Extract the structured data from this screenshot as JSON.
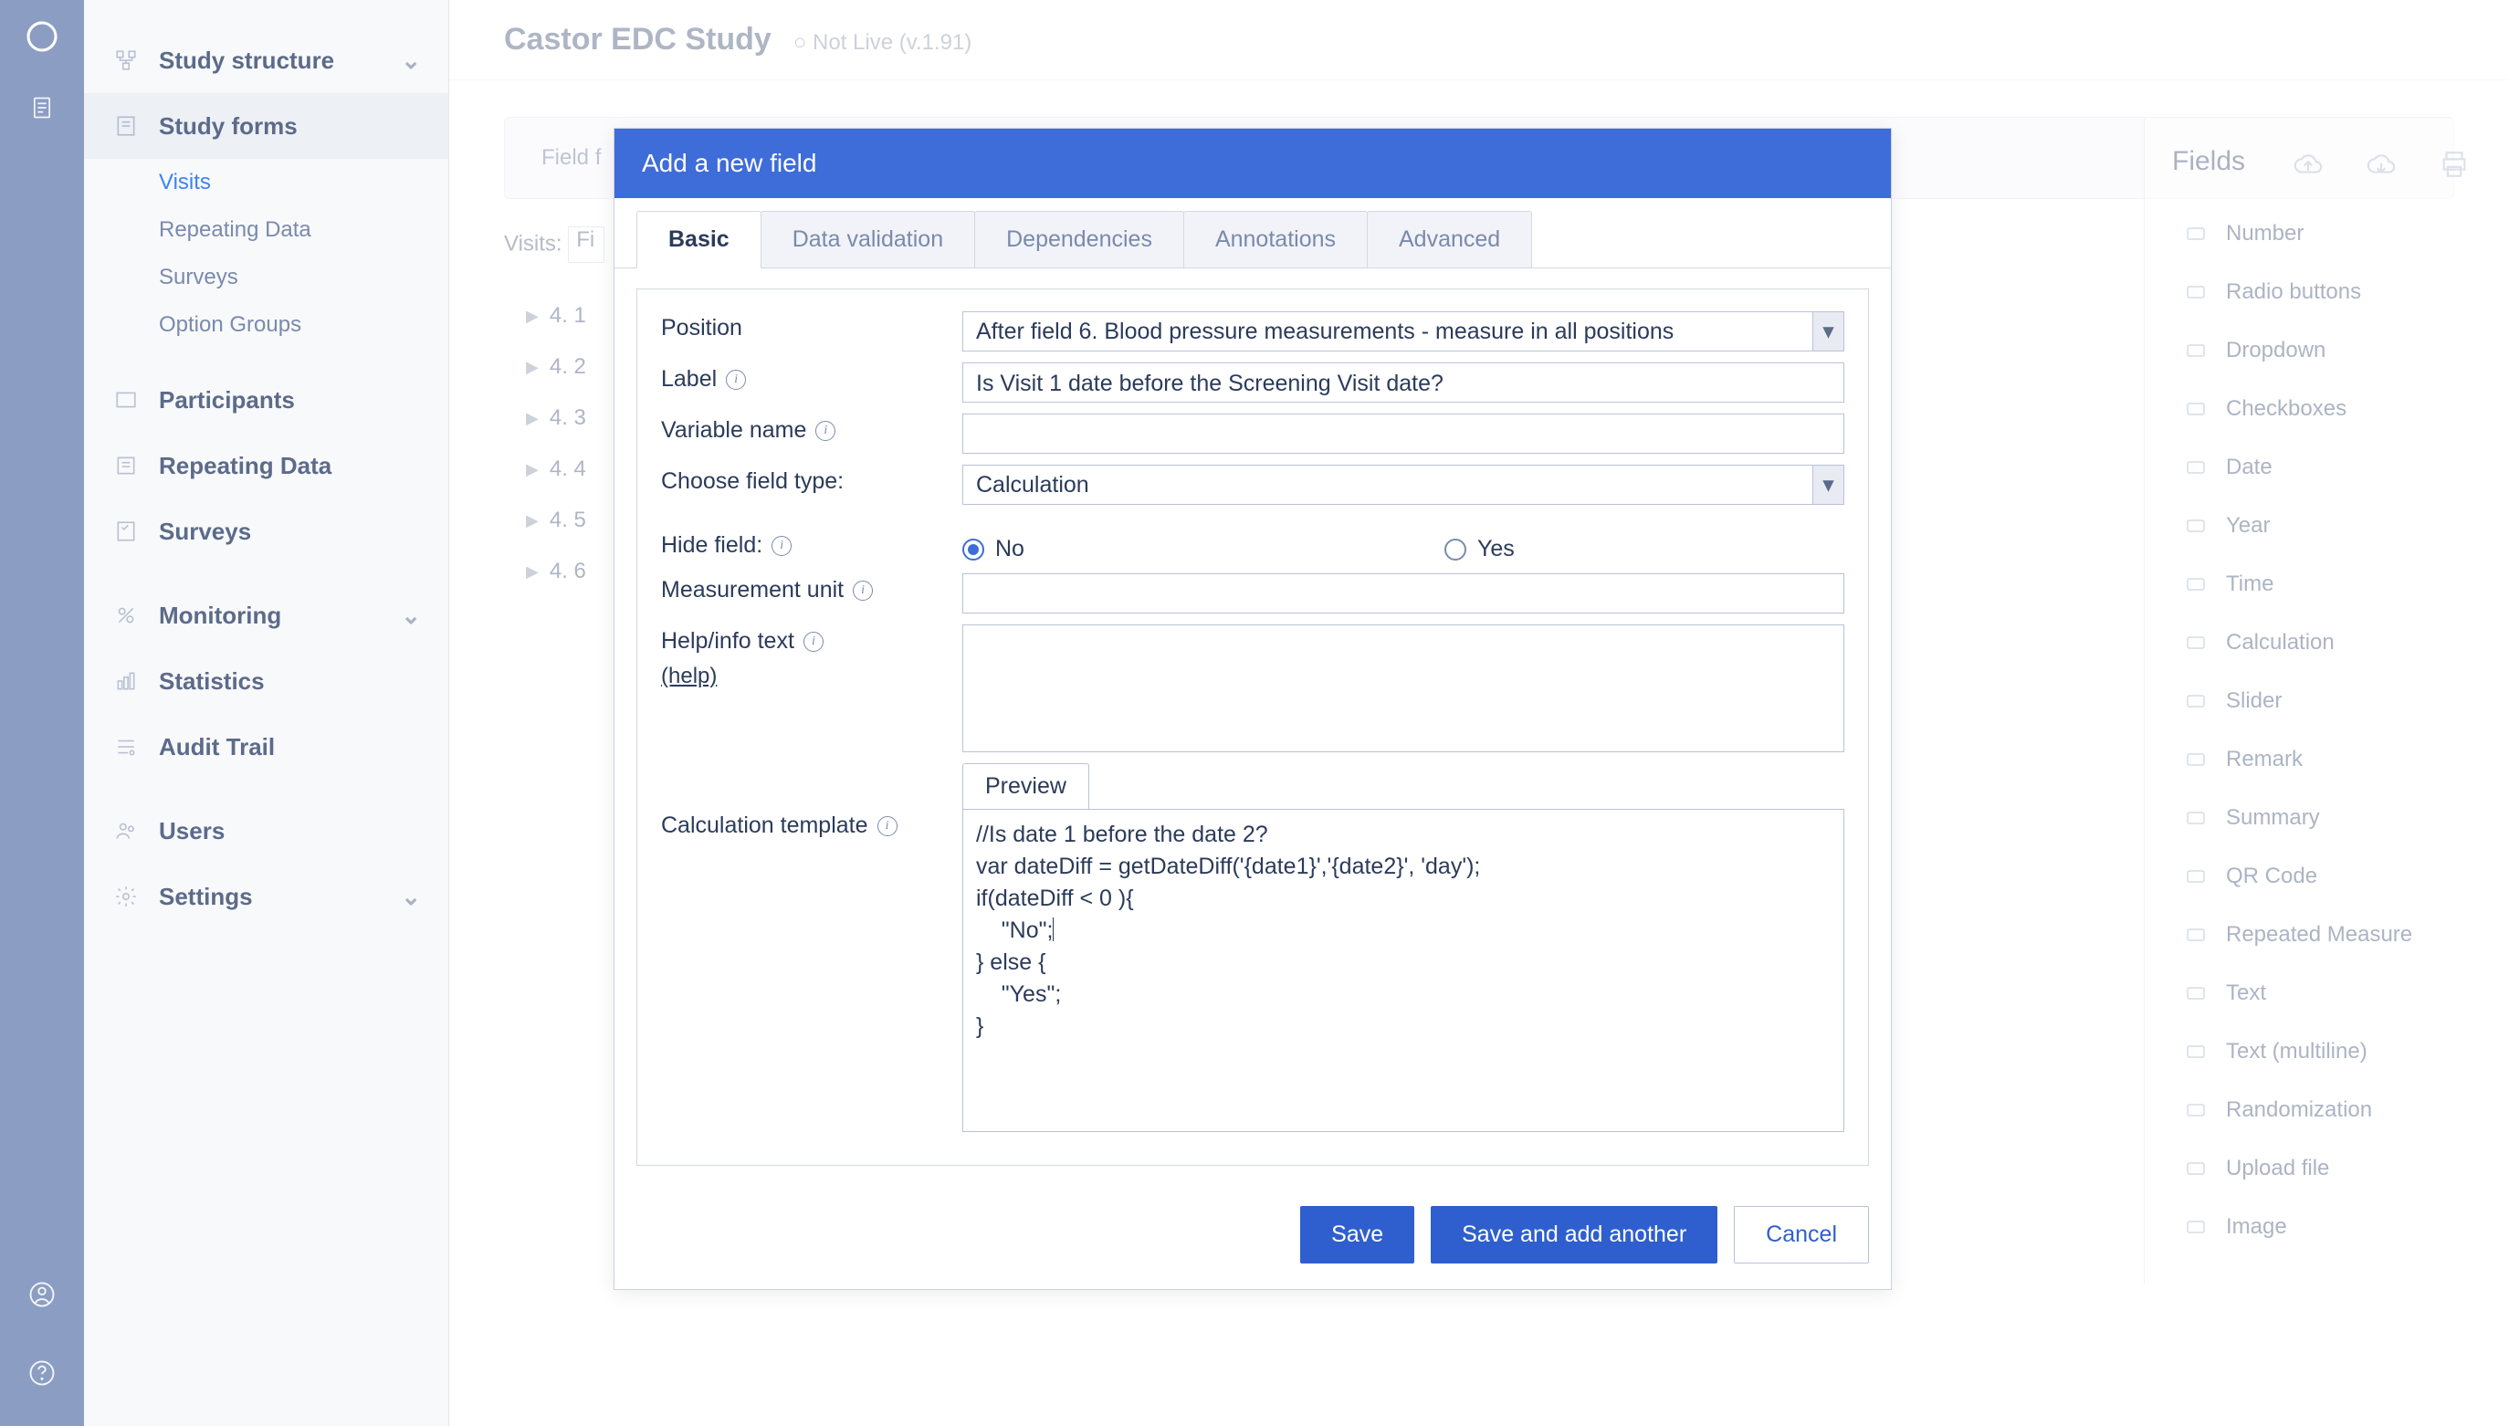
{
  "header": {
    "title": "Castor EDC Study",
    "status": "○ Not Live (v.1.91)"
  },
  "sidebar": {
    "study_structure": "Study structure",
    "study_forms": "Study forms",
    "sub": {
      "visits": "Visits",
      "repeating_data": "Repeating Data",
      "surveys": "Surveys",
      "option_groups": "Option Groups"
    },
    "participants": "Participants",
    "repeating_data_main": "Repeating Data",
    "surveys_main": "Surveys",
    "monitoring": "Monitoring",
    "statistics": "Statistics",
    "audit_trail": "Audit Trail",
    "users": "Users",
    "settings": "Settings"
  },
  "main": {
    "toolbar_placeholder": "Field f",
    "visits_label": "Visits:",
    "visits_value": "Fi",
    "tree": [
      {
        "label": "4. 1"
      },
      {
        "label": "4. 2"
      },
      {
        "label": "4. 3"
      },
      {
        "label": "4. 4"
      },
      {
        "label": "4. 5"
      },
      {
        "label": "4. 6"
      }
    ]
  },
  "fields": {
    "heading": "Fields",
    "items": [
      "Number",
      "Radio buttons",
      "Dropdown",
      "Checkboxes",
      "Date",
      "Year",
      "Time",
      "Calculation",
      "Slider",
      "Remark",
      "Summary",
      "QR Code",
      "Repeated Measure",
      "Text",
      "Text (multiline)",
      "Randomization",
      "Upload file",
      "Image"
    ]
  },
  "modal": {
    "title": "Add a new field",
    "tabs": [
      "Basic",
      "Data validation",
      "Dependencies",
      "Annotations",
      "Advanced"
    ],
    "labels": {
      "position": "Position",
      "label": "Label",
      "variable_name": "Variable name",
      "choose_type": "Choose field type:",
      "hide_field": "Hide field:",
      "measurement_unit": "Measurement unit",
      "help_info": "Help/info text",
      "help_link": "(help)",
      "calc_template": "Calculation template"
    },
    "values": {
      "position": "After field 6. Blood pressure measurements - measure in all positions",
      "label": "Is Visit 1 date before the Screening Visit date?",
      "variable_name": "",
      "field_type": "Calculation",
      "hide_no": "No",
      "hide_yes": "Yes",
      "measurement_unit": "",
      "help_info": "",
      "preview_btn": "Preview",
      "calc_lines": [
        "//Is date 1 before the date 2?",
        "var dateDiff = getDateDiff('{date1}','{date2}', 'day');",
        "if(dateDiff < 0 ){",
        "    \"No\";",
        "} else {",
        "    \"Yes\";",
        "}"
      ]
    },
    "buttons": {
      "save": "Save",
      "save_another": "Save and add another",
      "cancel": "Cancel"
    }
  }
}
